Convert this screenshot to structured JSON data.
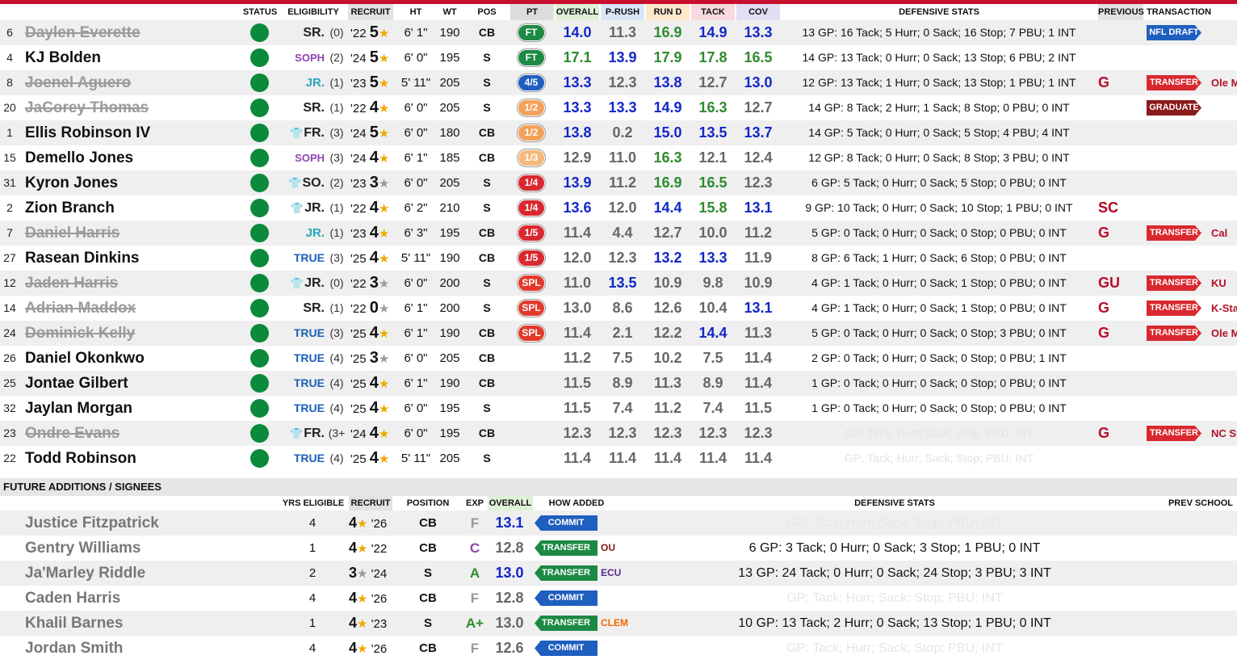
{
  "colors": {
    "accent": "#c8102e",
    "status_active": "#0a8a3a",
    "stat_blue": "#1226c9",
    "stat_green": "#2e8b2e"
  },
  "headers": {
    "status": "STATUS",
    "eligibility": "ELIGIBILITY",
    "recruit": "RECRUIT",
    "ht": "HT",
    "wt": "WT",
    "pos": "POS",
    "pt": "PT",
    "overall": "OVERALL",
    "prush": "P-RUSH",
    "rund": "RUN D",
    "tack": "TACK",
    "cov": "COV",
    "defensive_stats": "DEFENSIVE STATS",
    "previous": "PREVIOUS",
    "transaction": "TRANSACTION"
  },
  "players": [
    {
      "num": "6",
      "name": "Daylen Everette",
      "gone": true,
      "elig": "SR.",
      "elig_type": "sr",
      "redshirt": false,
      "yrs": "(0)",
      "year": "'22",
      "stars": "5",
      "ht": "6' 1\"",
      "wt": "190",
      "pos": "CB",
      "pt": "FT",
      "pt_type": "ft",
      "overall": "14.0",
      "prush": "11.3",
      "rund": "16.9",
      "tack": "14.9",
      "cov": "13.3",
      "oc": "b",
      "pc": "k",
      "rc": "g",
      "tc": "b",
      "cc": "b",
      "stats": "13 GP: 16 Tack; 5 Hurr; 0 Sack; 16 Stop; 7 PBU; 1 INT",
      "prev": "",
      "tx": "NFL DRAFT",
      "tx_type": "blue",
      "dest": ""
    },
    {
      "num": "4",
      "name": "KJ Bolden",
      "gone": false,
      "elig": "SOPH",
      "elig_type": "soph",
      "redshirt": false,
      "yrs": "(2)",
      "year": "'24",
      "stars": "5",
      "ht": "6' 0\"",
      "wt": "195",
      "pos": "S",
      "pt": "FT",
      "pt_type": "ft",
      "overall": "17.1",
      "prush": "13.9",
      "rund": "17.9",
      "tack": "17.8",
      "cov": "16.5",
      "oc": "g",
      "pc": "b",
      "rc": "g",
      "tc": "g",
      "cc": "g",
      "stats": "14 GP: 13 Tack; 0 Hurr; 0 Sack; 13 Stop; 6 PBU; 2 INT",
      "prev": "",
      "tx": "",
      "tx_type": "",
      "dest": ""
    },
    {
      "num": "8",
      "name": "Joenel Aguero",
      "gone": true,
      "elig": "JR.",
      "elig_type": "jr",
      "redshirt": false,
      "yrs": "(1)",
      "year": "'23",
      "stars": "5",
      "ht": "5' 11\"",
      "wt": "205",
      "pos": "S",
      "pt": "4/5",
      "pt_type": "b45",
      "overall": "13.3",
      "prush": "12.3",
      "rund": "13.8",
      "tack": "12.7",
      "cov": "13.0",
      "oc": "b",
      "pc": "k",
      "rc": "b",
      "tc": "k",
      "cc": "b",
      "stats": "12 GP: 13 Tack; 1 Hurr; 0 Sack; 13 Stop; 1 PBU; 1 INT",
      "prev": "G",
      "tx": "TRANSFER",
      "tx_type": "red",
      "dest": "Ole Miss"
    },
    {
      "num": "20",
      "name": "JaCorey Thomas",
      "gone": true,
      "elig": "SR.",
      "elig_type": "sr",
      "redshirt": false,
      "yrs": "(1)",
      "year": "'22",
      "stars": "4",
      "ht": "6' 0\"",
      "wt": "205",
      "pos": "S",
      "pt": "1/2",
      "pt_type": "half",
      "overall": "13.3",
      "prush": "13.3",
      "rund": "14.9",
      "tack": "16.3",
      "cov": "12.7",
      "oc": "b",
      "pc": "b",
      "rc": "b",
      "tc": "g",
      "cc": "k",
      "stats": "14 GP: 8 Tack; 2 Hurr; 1 Sack; 8 Stop; 0 PBU; 0 INT",
      "prev": "",
      "tx": "GRADUATE",
      "tx_type": "maroon",
      "dest": ""
    },
    {
      "num": "1",
      "name": "Ellis Robinson IV",
      "gone": false,
      "elig": "FR.",
      "elig_type": "fr",
      "redshirt": true,
      "yrs": "(3)",
      "year": "'24",
      "stars": "5",
      "ht": "6' 0\"",
      "wt": "180",
      "pos": "CB",
      "pt": "1/2",
      "pt_type": "half",
      "overall": "13.8",
      "prush": "0.2",
      "rund": "15.0",
      "tack": "13.5",
      "cov": "13.7",
      "oc": "b",
      "pc": "k",
      "rc": "b",
      "tc": "b",
      "cc": "b",
      "stats": "14 GP: 5 Tack; 0 Hurr; 0 Sack; 5 Stop; 4 PBU; 4 INT",
      "prev": "",
      "tx": "",
      "tx_type": "",
      "dest": ""
    },
    {
      "num": "15",
      "name": "Demello Jones",
      "gone": false,
      "elig": "SOPH",
      "elig_type": "soph",
      "redshirt": false,
      "yrs": "(3)",
      "year": "'24",
      "stars": "4",
      "ht": "6' 1\"",
      "wt": "185",
      "pos": "CB",
      "pt": "1/3",
      "pt_type": "third",
      "overall": "12.9",
      "prush": "11.0",
      "rund": "16.3",
      "tack": "12.1",
      "cov": "12.4",
      "oc": "k",
      "pc": "k",
      "rc": "g",
      "tc": "k",
      "cc": "k",
      "stats": "12 GP: 8 Tack; 0 Hurr; 0 Sack; 8 Stop; 3 PBU; 0 INT",
      "prev": "",
      "tx": "",
      "tx_type": "",
      "dest": ""
    },
    {
      "num": "31",
      "name": "Kyron Jones",
      "gone": false,
      "elig": "SO.",
      "elig_type": "so",
      "redshirt": true,
      "yrs": "(2)",
      "year": "'23",
      "stars": "3",
      "ht": "6' 0\"",
      "wt": "205",
      "pos": "S",
      "pt": "1/4",
      "pt_type": "q",
      "overall": "13.9",
      "prush": "11.2",
      "rund": "16.9",
      "tack": "16.5",
      "cov": "12.3",
      "oc": "b",
      "pc": "k",
      "rc": "g",
      "tc": "g",
      "cc": "k",
      "stats": "6 GP: 5 Tack; 0 Hurr; 0 Sack; 5 Stop; 0 PBU; 0 INT",
      "prev": "",
      "tx": "",
      "tx_type": "",
      "dest": ""
    },
    {
      "num": "2",
      "name": "Zion Branch",
      "gone": false,
      "elig": "JR.",
      "elig_type": "rjr",
      "redshirt": true,
      "yrs": "(1)",
      "year": "'22",
      "stars": "4",
      "ht": "6' 2\"",
      "wt": "210",
      "pos": "S",
      "pt": "1/4",
      "pt_type": "q",
      "overall": "13.6",
      "prush": "12.0",
      "rund": "14.4",
      "tack": "15.8",
      "cov": "13.1",
      "oc": "b",
      "pc": "k",
      "rc": "b",
      "tc": "g",
      "cc": "b",
      "stats": "9 GP: 10 Tack; 0 Hurr; 0 Sack; 10 Stop; 1 PBU; 0 INT",
      "prev": "SC",
      "tx": "",
      "tx_type": "",
      "dest": ""
    },
    {
      "num": "7",
      "name": "Daniel Harris",
      "gone": true,
      "elig": "JR.",
      "elig_type": "jr",
      "redshirt": false,
      "yrs": "(1)",
      "year": "'23",
      "stars": "4",
      "ht": "6' 3\"",
      "wt": "195",
      "pos": "CB",
      "pt": "1/5",
      "pt_type": "q",
      "overall": "11.4",
      "prush": "4.4",
      "rund": "12.7",
      "tack": "10.0",
      "cov": "11.2",
      "oc": "k",
      "pc": "k",
      "rc": "k",
      "tc": "k",
      "cc": "k",
      "stats": "5 GP: 0 Tack; 0 Hurr; 0 Sack; 0 Stop; 0 PBU; 0 INT",
      "prev": "G",
      "tx": "TRANSFER",
      "tx_type": "red",
      "dest": "Cal"
    },
    {
      "num": "27",
      "name": "Rasean Dinkins",
      "gone": false,
      "elig": "TRUE",
      "elig_type": "true",
      "redshirt": false,
      "yrs": "(3)",
      "year": "'25",
      "stars": "4",
      "ht": "5' 11\"",
      "wt": "190",
      "pos": "CB",
      "pt": "1/5",
      "pt_type": "q",
      "overall": "12.0",
      "prush": "12.3",
      "rund": "13.2",
      "tack": "13.3",
      "cov": "11.9",
      "oc": "k",
      "pc": "k",
      "rc": "b",
      "tc": "b",
      "cc": "k",
      "stats": "8 GP: 6 Tack; 1 Hurr; 0 Sack; 6 Stop; 0 PBU; 0 INT",
      "prev": "",
      "tx": "",
      "tx_type": "",
      "dest": ""
    },
    {
      "num": "12",
      "name": "Jaden Harris",
      "gone": true,
      "elig": "JR.",
      "elig_type": "rjr",
      "redshirt": true,
      "yrs": "(0)",
      "year": "'22",
      "stars": "3",
      "ht": "6' 0\"",
      "wt": "200",
      "pos": "S",
      "pt": "SPL",
      "pt_type": "spl",
      "overall": "11.0",
      "prush": "13.5",
      "rund": "10.9",
      "tack": "9.8",
      "cov": "10.9",
      "oc": "k",
      "pc": "b",
      "rc": "k",
      "tc": "k",
      "cc": "k",
      "stats": "4 GP: 1 Tack; 0 Hurr; 0 Sack; 1 Stop; 0 PBU; 0 INT",
      "prev": "GU",
      "tx": "TRANSFER",
      "tx_type": "red",
      "dest": "KU"
    },
    {
      "num": "14",
      "name": "Adrian Maddox",
      "gone": true,
      "elig": "SR.",
      "elig_type": "sr",
      "redshirt": false,
      "yrs": "(1)",
      "year": "'22",
      "stars": "0",
      "ht": "6' 1\"",
      "wt": "200",
      "pos": "S",
      "pt": "SPL",
      "pt_type": "spl",
      "overall": "13.0",
      "prush": "8.6",
      "rund": "12.6",
      "tack": "10.4",
      "cov": "13.1",
      "oc": "k",
      "pc": "k",
      "rc": "k",
      "tc": "k",
      "cc": "b",
      "stats": "4 GP: 1 Tack; 0 Hurr; 0 Sack; 1 Stop; 0 PBU; 0 INT",
      "prev": "G",
      "tx": "TRANSFER",
      "tx_type": "red",
      "dest": "K-State"
    },
    {
      "num": "24",
      "name": "Dominick Kelly",
      "gone": true,
      "elig": "TRUE",
      "elig_type": "true",
      "redshirt": false,
      "yrs": "(3)",
      "year": "'25",
      "stars": "4",
      "ht": "6' 1\"",
      "wt": "190",
      "pos": "CB",
      "pt": "SPL",
      "pt_type": "spl",
      "overall": "11.4",
      "prush": "2.1",
      "rund": "12.2",
      "tack": "14.4",
      "cov": "11.3",
      "oc": "k",
      "pc": "k",
      "rc": "k",
      "tc": "b",
      "cc": "k",
      "stats": "5 GP: 0 Tack; 0 Hurr; 0 Sack; 0 Stop; 3 PBU; 0 INT",
      "prev": "G",
      "tx": "TRANSFER",
      "tx_type": "red",
      "dest": "Ole Miss"
    },
    {
      "num": "26",
      "name": "Daniel Okonkwo",
      "gone": false,
      "elig": "TRUE",
      "elig_type": "true",
      "redshirt": false,
      "yrs": "(4)",
      "year": "'25",
      "stars": "3",
      "ht": "6' 0\"",
      "wt": "205",
      "pos": "CB",
      "pt": "",
      "pt_type": "",
      "overall": "11.2",
      "prush": "7.5",
      "rund": "10.2",
      "tack": "7.5",
      "cov": "11.4",
      "oc": "k",
      "pc": "k",
      "rc": "k",
      "tc": "k",
      "cc": "k",
      "stats": "2 GP: 0 Tack; 0 Hurr; 0 Sack; 0 Stop; 0 PBU; 1 INT",
      "prev": "",
      "tx": "",
      "tx_type": "",
      "dest": ""
    },
    {
      "num": "25",
      "name": "Jontae Gilbert",
      "gone": false,
      "elig": "TRUE",
      "elig_type": "true",
      "redshirt": false,
      "yrs": "(4)",
      "year": "'25",
      "stars": "4",
      "ht": "6' 1\"",
      "wt": "190",
      "pos": "CB",
      "pt": "",
      "pt_type": "",
      "overall": "11.5",
      "prush": "8.9",
      "rund": "11.3",
      "tack": "8.9",
      "cov": "11.4",
      "oc": "k",
      "pc": "k",
      "rc": "k",
      "tc": "k",
      "cc": "k",
      "stats": "1 GP: 0 Tack; 0 Hurr; 0 Sack; 0 Stop; 0 PBU; 0 INT",
      "prev": "",
      "tx": "",
      "tx_type": "",
      "dest": ""
    },
    {
      "num": "32",
      "name": "Jaylan Morgan",
      "gone": false,
      "elig": "TRUE",
      "elig_type": "true",
      "redshirt": false,
      "yrs": "(4)",
      "year": "'25",
      "stars": "4",
      "ht": "6' 0\"",
      "wt": "195",
      "pos": "S",
      "pt": "",
      "pt_type": "",
      "overall": "11.5",
      "prush": "7.4",
      "rund": "11.2",
      "tack": "7.4",
      "cov": "11.5",
      "oc": "k",
      "pc": "k",
      "rc": "k",
      "tc": "k",
      "cc": "k",
      "stats": "1 GP: 0 Tack; 0 Hurr; 0 Sack; 0 Stop; 0 PBU; 0 INT",
      "prev": "",
      "tx": "",
      "tx_type": "",
      "dest": ""
    },
    {
      "num": "23",
      "name": "Ondre Evans",
      "gone": true,
      "elig": "FR.",
      "elig_type": "fr",
      "redshirt": true,
      "yrs": "(3+",
      "year": "'24",
      "stars": "4",
      "ht": "6' 0\"",
      "wt": "195",
      "pos": "CB",
      "pt": "",
      "pt_type": "",
      "overall": "12.3",
      "prush": "12.3",
      "rund": "12.3",
      "tack": "12.3",
      "cov": "12.3",
      "oc": "k",
      "pc": "k",
      "rc": "k",
      "tc": "k",
      "cc": "k",
      "stats": "GP: Tack; Hurr; Sack; Stop; PBU; INT",
      "ghost": true,
      "prev": "G",
      "tx": "TRANSFER",
      "tx_type": "red",
      "dest": "NC State"
    },
    {
      "num": "22",
      "name": "Todd Robinson",
      "gone": false,
      "elig": "TRUE",
      "elig_type": "true",
      "redshirt": false,
      "yrs": "(4)",
      "year": "'25",
      "stars": "4",
      "ht": "5' 11\"",
      "wt": "205",
      "pos": "S",
      "pt": "",
      "pt_type": "",
      "overall": "11.4",
      "prush": "11.4",
      "rund": "11.4",
      "tack": "11.4",
      "cov": "11.4",
      "oc": "k",
      "pc": "k",
      "rc": "k",
      "tc": "k",
      "cc": "k",
      "stats": "GP: Tack; Hurr; Sack; Stop; PBU; INT",
      "ghost": true,
      "prev": "",
      "tx": "",
      "tx_type": "",
      "dest": ""
    }
  ],
  "future": {
    "title": "FUTURE ADDITIONS / SIGNEES",
    "headers": {
      "yrs": "YRS ELIGIBLE",
      "recruit": "RECRUIT",
      "position": "POSITION",
      "exp": "EXP",
      "overall": "OVERALL",
      "how": "HOW ADDED",
      "defensive_stats": "DEFENSIVE STATS",
      "prev_school": "PREV SCHOOL"
    },
    "rows": [
      {
        "name": "Justice Fitzpatrick",
        "yrs": "4",
        "stars": "4",
        "year": "'26",
        "pos": "CB",
        "exp": "F",
        "exp_cls": "F",
        "overall": "13.1",
        "ov_cls": "b",
        "how": "COMMIT",
        "how_type": "commit",
        "prev": "",
        "stats": "GP: Tack; Hurr; Sack; Stop; PBU; INT",
        "ghost": true
      },
      {
        "name": "Gentry Williams",
        "yrs": "1",
        "stars": "4",
        "year": "'22",
        "pos": "CB",
        "exp": "C",
        "exp_cls": "C",
        "overall": "12.8",
        "ov_cls": "k",
        "how": "TRANSFER",
        "how_type": "transfer",
        "prev": "OU",
        "stats": "6 GP: 3 Tack; 0 Hurr; 0 Sack; 3 Stop; 1 PBU; 0 INT",
        "ghost": false
      },
      {
        "name": "Ja'Marley Riddle",
        "yrs": "2",
        "stars": "3",
        "year": "'24",
        "pos": "S",
        "exp": "A",
        "exp_cls": "A",
        "overall": "13.0",
        "ov_cls": "b",
        "how": "TRANSFER",
        "how_type": "transfer",
        "prev": "ECU",
        "stats": "13 GP: 24 Tack; 0 Hurr; 0 Sack; 24 Stop; 3 PBU; 3 INT",
        "ghost": false
      },
      {
        "name": "Caden Harris",
        "yrs": "4",
        "stars": "4",
        "year": "'26",
        "pos": "CB",
        "exp": "F",
        "exp_cls": "F",
        "overall": "12.8",
        "ov_cls": "k",
        "how": "COMMIT",
        "how_type": "commit",
        "prev": "",
        "stats": "GP: Tack; Hurr; Sack; Stop; PBU; INT",
        "ghost": true
      },
      {
        "name": "Khalil Barnes",
        "yrs": "1",
        "stars": "4",
        "year": "'23",
        "pos": "S",
        "exp": "A+",
        "exp_cls": "Ap",
        "overall": "13.0",
        "ov_cls": "k",
        "how": "TRANSFER",
        "how_type": "transfer",
        "prev": "CLEM",
        "stats": "10 GP: 13 Tack; 2 Hurr; 0 Sack; 13 Stop; 1 PBU; 0 INT",
        "ghost": false
      },
      {
        "name": "Jordan Smith",
        "yrs": "4",
        "stars": "4",
        "year": "'26",
        "pos": "CB",
        "exp": "F",
        "exp_cls": "F",
        "overall": "12.6",
        "ov_cls": "k",
        "how": "COMMIT",
        "how_type": "commit",
        "prev": "",
        "stats": "GP: Tack; Hurr; Sack; Stop; PBU; INT",
        "ghost": true
      }
    ]
  }
}
